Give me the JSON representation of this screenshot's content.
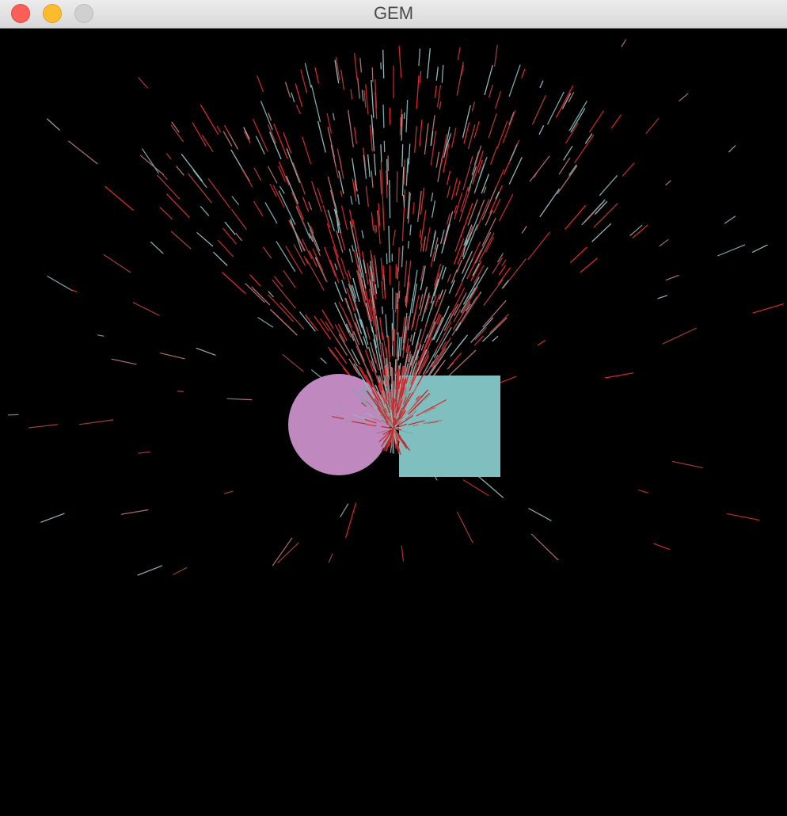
{
  "window": {
    "title": "GEM",
    "buttons": {
      "close": "close-button",
      "minimize": "minimize-button",
      "zoom": "zoom-button"
    }
  },
  "scene": {
    "background": "#000000",
    "circle_color": "#bf88bf",
    "square_color": "#7fbfbf",
    "particle_colors": [
      "#c0272d",
      "#e0262c",
      "#8fb8b8",
      "#b07070",
      "#a83a3a",
      "#7aa9a9"
    ]
  }
}
